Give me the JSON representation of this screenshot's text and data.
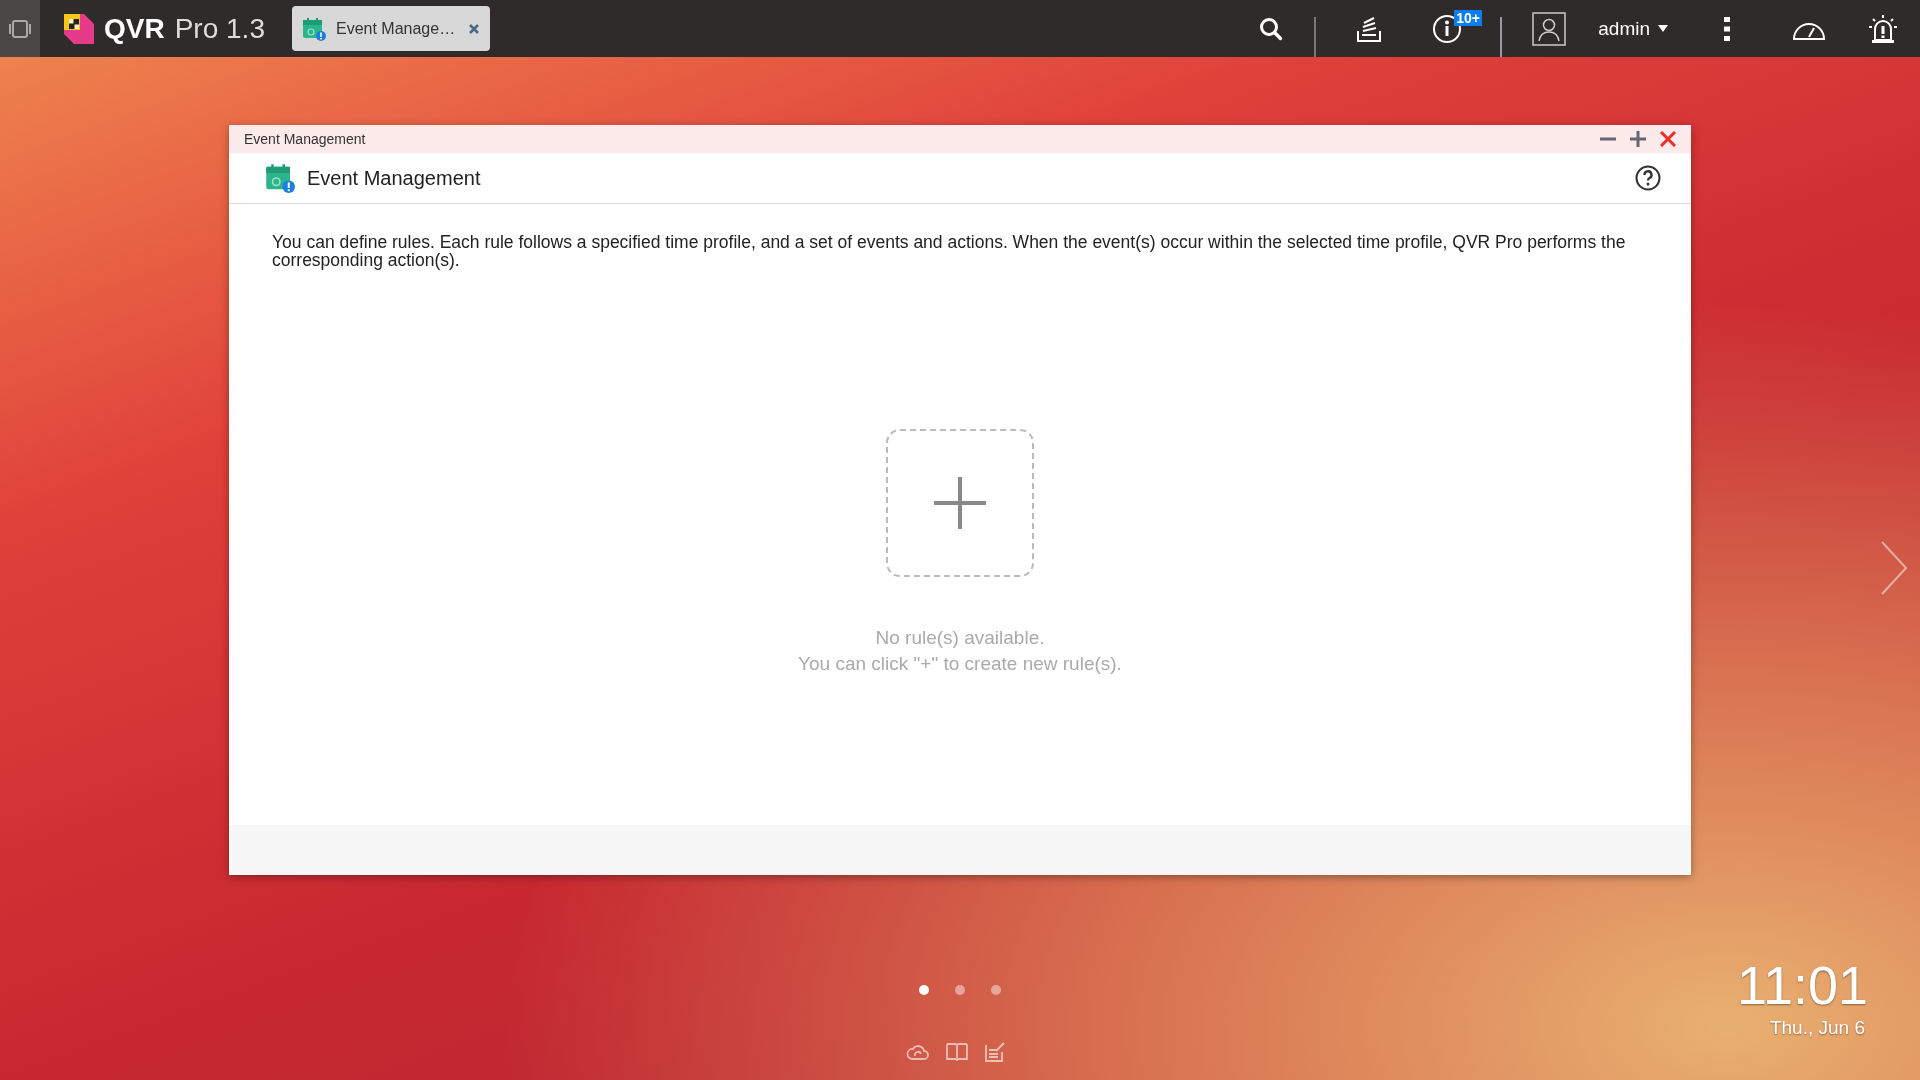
{
  "topbar": {
    "app_name": "QVR",
    "app_suffix": "Pro 1.3",
    "tabs": [
      {
        "label": "Event Manage…",
        "selected": true
      }
    ],
    "notification_badge": "10+",
    "user": "admin"
  },
  "window": {
    "title": "Event Management",
    "header": "Event Management",
    "description": "You can define rules. Each rule follows a specified time profile, and a set of events and actions. When the event(s) occur within the selected time profile, QVR Pro performs the corresponding action(s).",
    "empty_title": "No rule(s) available.",
    "empty_hint": "You can click \"+\" to create new rule(s)."
  },
  "desktop": {
    "pages": [
      {
        "selected": true
      },
      {
        "selected": false
      },
      {
        "selected": false
      }
    ],
    "time": "11:01",
    "date": "Thu., Jun 6"
  }
}
